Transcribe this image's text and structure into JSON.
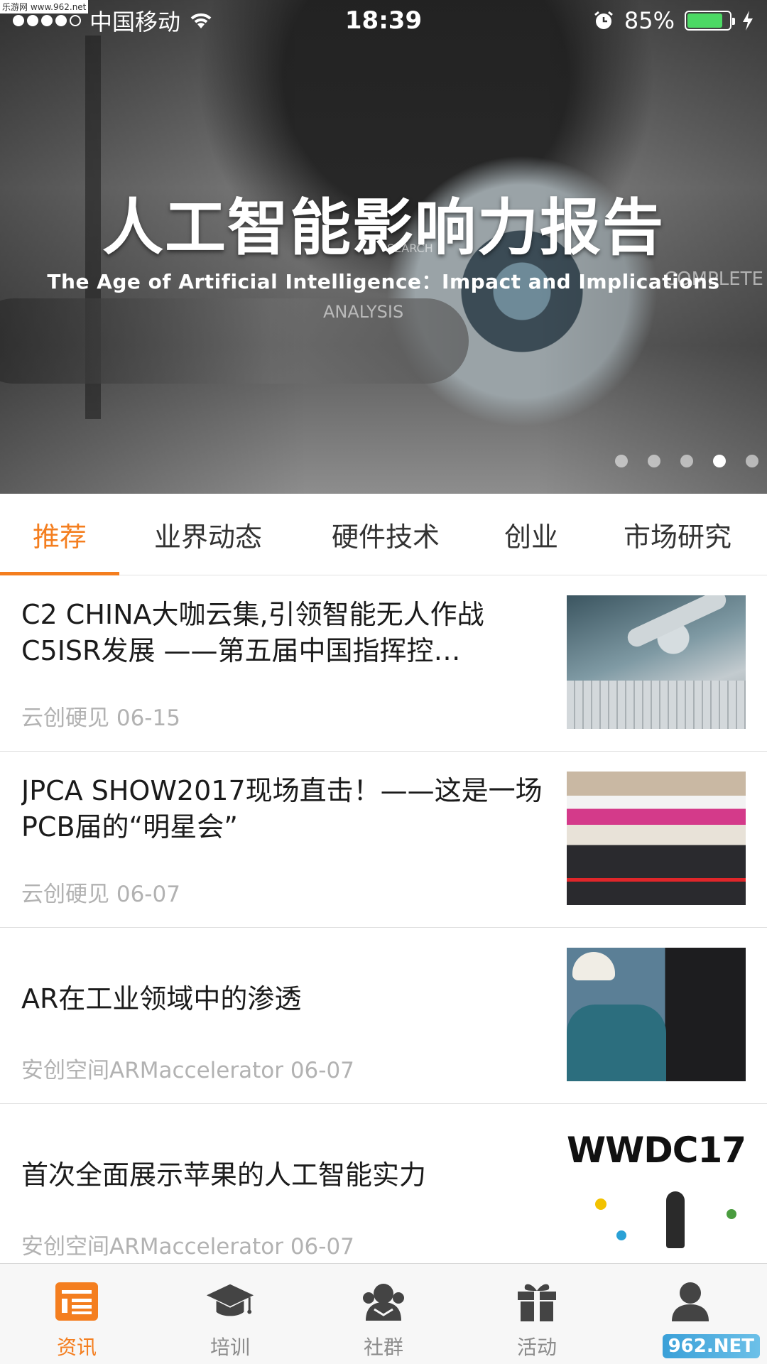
{
  "status_bar": {
    "carrier": "中国移动",
    "time": "18:39",
    "battery": "85%",
    "battery_level": 0.85,
    "watermark": "乐游网 www.962.net"
  },
  "banner": {
    "title": "人工智能影响力报告",
    "subtitle": "The Age of Artificial Intelligence：Impact and Implications",
    "extra_text": [
      "SEARCH",
      "ANALYSIS",
      "COMPLETE"
    ],
    "page_count": 5,
    "active_page": 4
  },
  "tabs": [
    {
      "label": "推荐",
      "active": true
    },
    {
      "label": "业界动态",
      "active": false
    },
    {
      "label": "硬件技术",
      "active": false
    },
    {
      "label": "创业",
      "active": false
    },
    {
      "label": "市场研究",
      "active": false
    }
  ],
  "articles": [
    {
      "title": "C2 CHINA大咖云集,引领智能无人作战C5ISR发展 ——第五届中国指挥控…",
      "source": "云创硬见",
      "date": "06-15"
    },
    {
      "title": "JPCA SHOW2017现场直击！——这是一场PCB届的“明星会”",
      "source": "云创硬见",
      "date": "06-07"
    },
    {
      "title": "AR在工业领域中的渗透",
      "source": "安创空间ARMaccelerator",
      "date": "06-07"
    },
    {
      "title": "首次全面展示苹果的人工智能实力",
      "source": "安创空间ARMaccelerator",
      "date": "06-07"
    }
  ],
  "thumb_texts": {
    "wwdc": "WWDC17"
  },
  "bottom_nav": [
    {
      "label": "资讯",
      "icon": "news-icon",
      "active": true
    },
    {
      "label": "培训",
      "icon": "graduation-cap-icon",
      "active": false
    },
    {
      "label": "社群",
      "icon": "community-icon",
      "active": false
    },
    {
      "label": "活动",
      "icon": "gift-icon",
      "active": false
    },
    {
      "label": "",
      "icon": "profile-icon",
      "active": false
    }
  ],
  "corner_mark": "962.NET",
  "colors": {
    "accent": "#f47e1f",
    "battery_green": "#4cd964"
  }
}
